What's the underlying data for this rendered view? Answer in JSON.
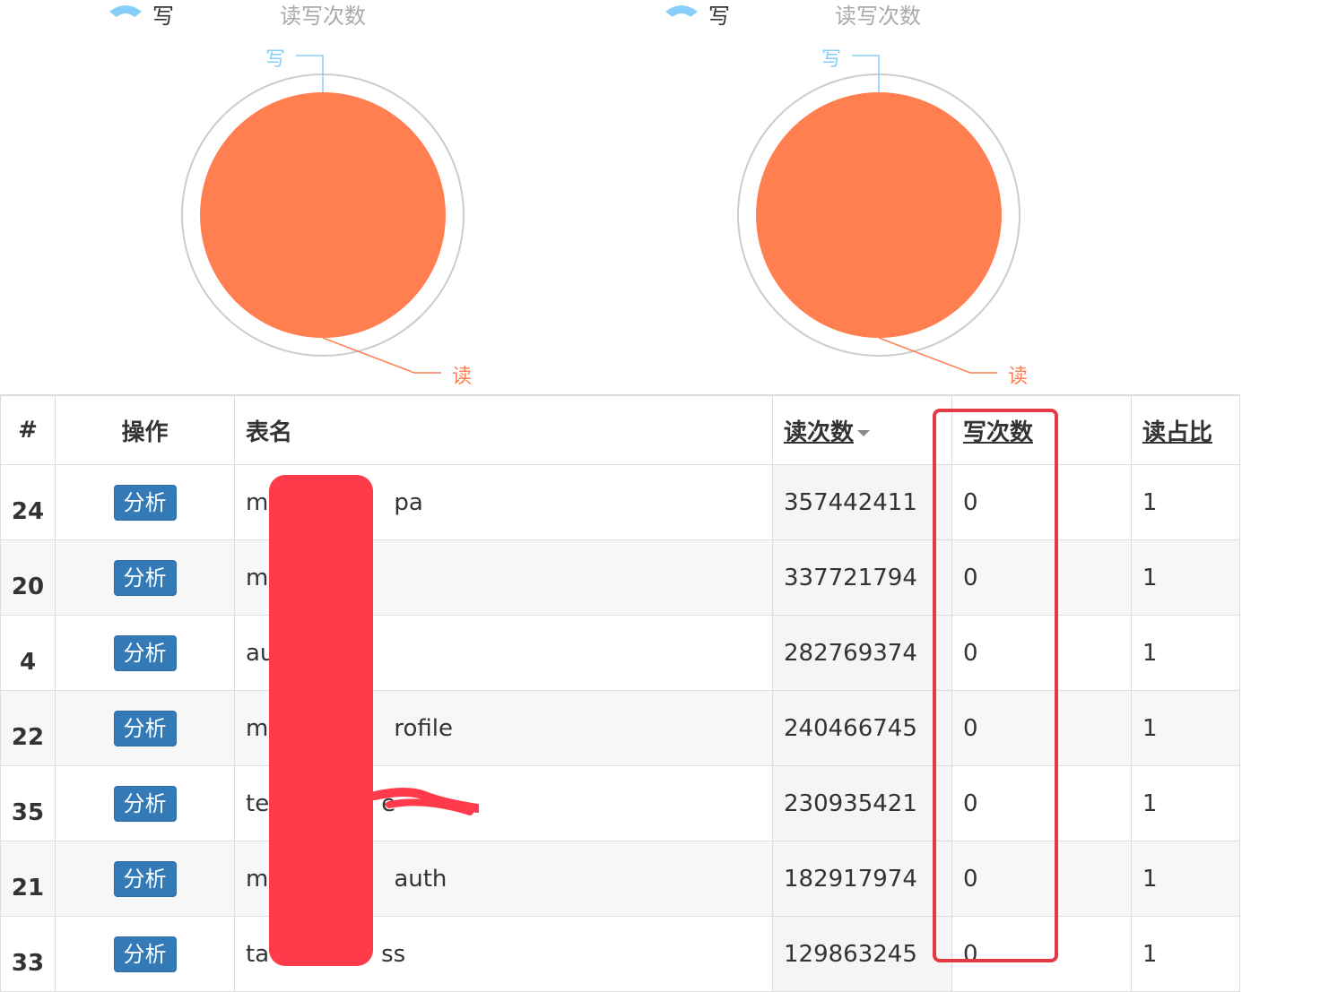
{
  "charts": [
    {
      "legend_label": "写",
      "title": "读写次数",
      "slices": [
        {
          "label": "读",
          "value": 1,
          "color": "#ff7f50"
        },
        {
          "label": "写",
          "value": 0,
          "color": "#87cefa"
        }
      ]
    },
    {
      "legend_label": "写",
      "title": "读写次数",
      "slices": [
        {
          "label": "读",
          "value": 1,
          "color": "#ff7f50"
        },
        {
          "label": "写",
          "value": 0,
          "color": "#87cefa"
        }
      ]
    }
  ],
  "table": {
    "headers": {
      "index": "#",
      "action": "操作",
      "table_name": "表名",
      "read_count": "读次数",
      "write_count": "写次数",
      "read_ratio": "读占比"
    },
    "action_label": "分析",
    "rows": [
      {
        "index": "24",
        "name": "m",
        "name_tail": "pa",
        "reads": "357442411",
        "writes": "0",
        "ratio": "1"
      },
      {
        "index": "20",
        "name": "m",
        "name_tail": "",
        "reads": "337721794",
        "writes": "0",
        "ratio": "1"
      },
      {
        "index": "4",
        "name": "au",
        "name_tail": "",
        "reads": "282769374",
        "writes": "0",
        "ratio": "1"
      },
      {
        "index": "22",
        "name": "m",
        "name_tail": "rofile",
        "reads": "240466745",
        "writes": "0",
        "ratio": "1"
      },
      {
        "index": "35",
        "name": "te",
        "name_tail": "e",
        "reads": "230935421",
        "writes": "0",
        "ratio": "1"
      },
      {
        "index": "21",
        "name": "m",
        "name_tail": "auth",
        "reads": "182917974",
        "writes": "0",
        "ratio": "1"
      },
      {
        "index": "33",
        "name": "ta",
        "name_tail": "ss",
        "reads": "129863245",
        "writes": "0",
        "ratio": "1"
      }
    ]
  },
  "colors": {
    "read": "#ff7f50",
    "write": "#87cefa",
    "button": "#337ab7",
    "highlight": "#e63946",
    "redaction": "#ff3a4a"
  }
}
